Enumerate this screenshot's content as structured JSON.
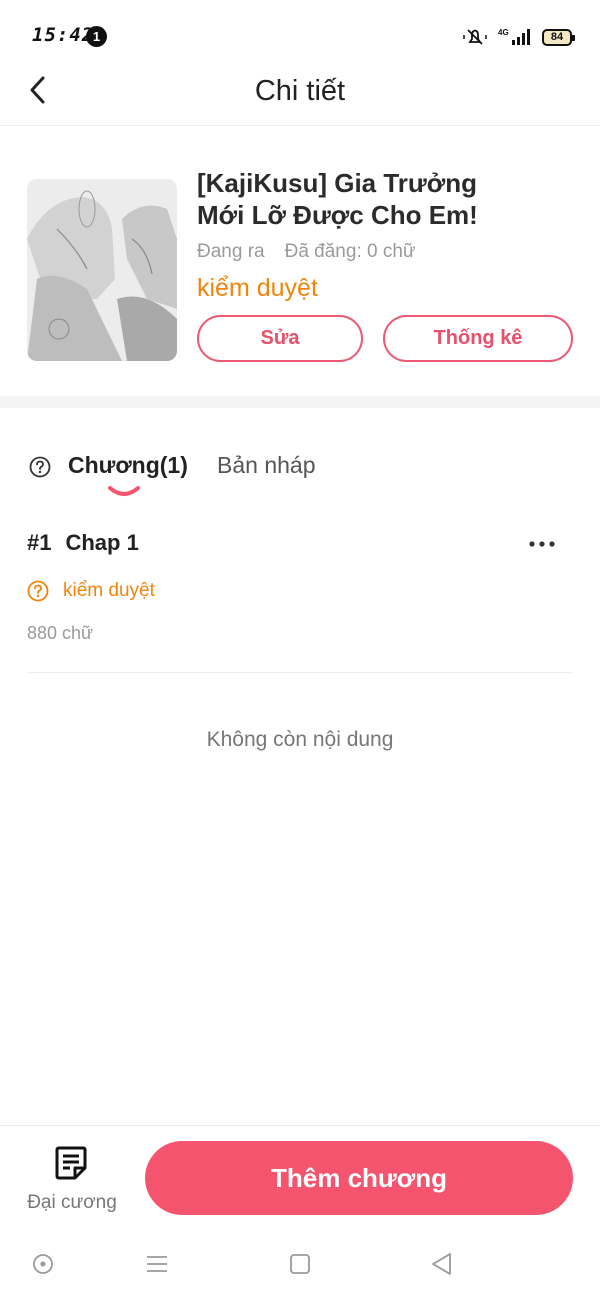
{
  "status_bar": {
    "time": "15:42",
    "notification_count": "1",
    "network": "4G",
    "battery": "84"
  },
  "header": {
    "title": "Chi tiết"
  },
  "book": {
    "title": "[KajiKusu] Gia Trưởng Mới Lỡ Được Cho Em!",
    "status": "Đang ra",
    "published": "Đã đăng: 0 chữ",
    "review_status": "kiểm duyệt",
    "edit_label": "Sửa",
    "stats_label": "Thống kê"
  },
  "tabs": {
    "chapters_label": "Chương(1)",
    "drafts_label": "Bản nháp"
  },
  "chapters": [
    {
      "number": "#1",
      "title": "Chap 1",
      "status": "kiểm duyệt",
      "word_count": "880 chữ"
    }
  ],
  "empty_message": "Không còn nội dung",
  "bottom_bar": {
    "outline_label": "Đại cương",
    "add_chapter_label": "Thêm chương"
  },
  "colors": {
    "accent": "#f5546f",
    "warning": "#f0850e",
    "muted": "#9a9a9a"
  },
  "icons": [
    "back-arrow-icon",
    "help-circle-icon",
    "more-dots-icon",
    "outline-document-icon",
    "nav-home-icon",
    "nav-menu-icon",
    "nav-recent-icon",
    "nav-back-icon"
  ]
}
